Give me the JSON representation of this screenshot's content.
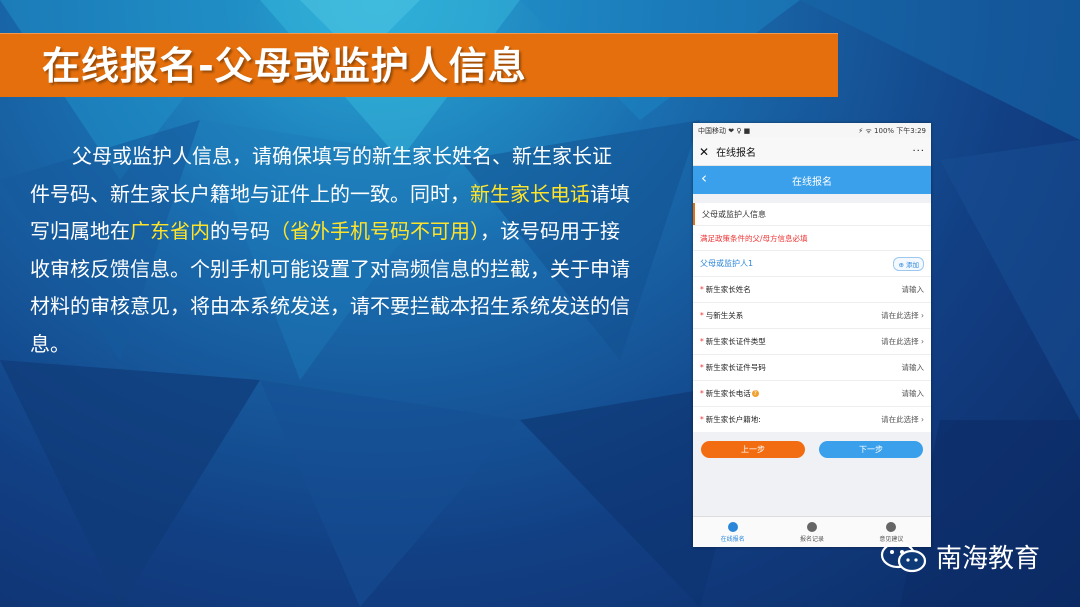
{
  "slide": {
    "title": "在线报名-父母或监护人信息",
    "paragraph": {
      "p1": "父母或监护人信息，请确保填写的新生家长姓名、新生家长证件号码、新生家长户籍地与证件上的一致。同时，",
      "h1": "新生家长电话",
      "p2": "请填写归属地在",
      "h2": "广东省内",
      "p3": "的号码",
      "h3": "（省外手机号码不可用）",
      "p4": "，该号码用于接收审核反馈信息。个别手机可能设置了对高频信息的拦截，关于申请材料的审核意见，将由本系统发送，请不要拦截本招生系统发送的信息。"
    },
    "brand": "南海教育",
    "colors": {
      "title_bar": "#e46f0c",
      "highlight": "#ffe42a"
    }
  },
  "phone": {
    "status_left": "中国移动 ❤ ♀ ■",
    "status_right": "⚡ ᯤ 100% 下午3:29",
    "appbar_title": "在线报名",
    "appbar_more": "···",
    "header_title": "在线报名",
    "section_title": "父母或监护人信息",
    "notice": "满足政策条件的父/母方信息必填",
    "guardian_label": "父母或监护人1",
    "add_label": "添加",
    "fields": [
      {
        "label": "新生家长姓名",
        "value": "请输入"
      },
      {
        "label": "与新生关系",
        "value": "请在此选择 ›"
      },
      {
        "label": "新生家长证件类型",
        "value": "请在此选择 ›"
      },
      {
        "label": "新生家长证件号码",
        "value": "请输入"
      },
      {
        "label": "新生家长电话",
        "value": "请输入"
      },
      {
        "label": "新生家长户籍地:",
        "value": "请在此选择 ›"
      }
    ],
    "prev_button": "上一步",
    "next_button": "下一步",
    "tabs": [
      "在线报名",
      "报名记录",
      "意见建议"
    ]
  }
}
